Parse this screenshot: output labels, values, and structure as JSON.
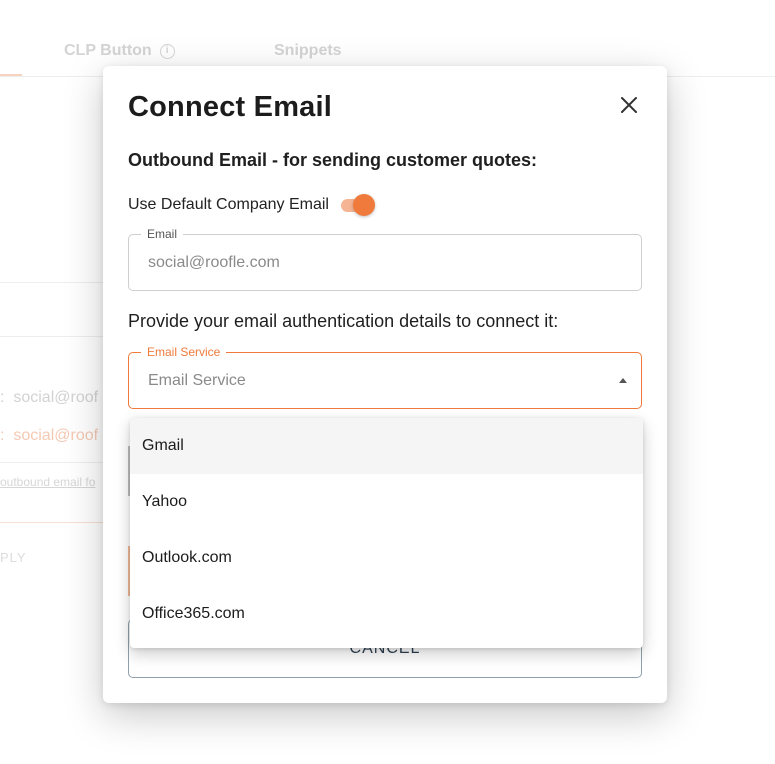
{
  "background": {
    "tabs": [
      {
        "label": "CLP Button",
        "has_info_icon": true
      },
      {
        "label": "Snippets"
      }
    ],
    "email_lines": [
      "social@roof",
      "social@roof"
    ],
    "link_text": "outbound email fo",
    "apply_text": "PLY"
  },
  "dialog": {
    "title": "Connect Email",
    "close_icon": "close-icon",
    "outbound_heading": "Outbound Email - for sending customer quotes:",
    "default_toggle": {
      "label": "Use Default Company Email",
      "on": true
    },
    "email_field": {
      "label": "Email",
      "value": "social@roofle.com"
    },
    "auth_instructions": "Provide your email authentication details to connect it:",
    "service_field": {
      "label": "Email Service",
      "placeholder": "Email Service",
      "open": true
    },
    "cancel_label": "CANCEL"
  },
  "dropdown": {
    "options": [
      "Gmail",
      "Yahoo",
      "Outlook.com",
      "Office365.com"
    ],
    "highlighted": "Gmail"
  },
  "colors": {
    "accent": "#f07a3c",
    "accent_light": "#f5b595",
    "text": "#1c1c1c",
    "muted": "#8a8a8a"
  }
}
